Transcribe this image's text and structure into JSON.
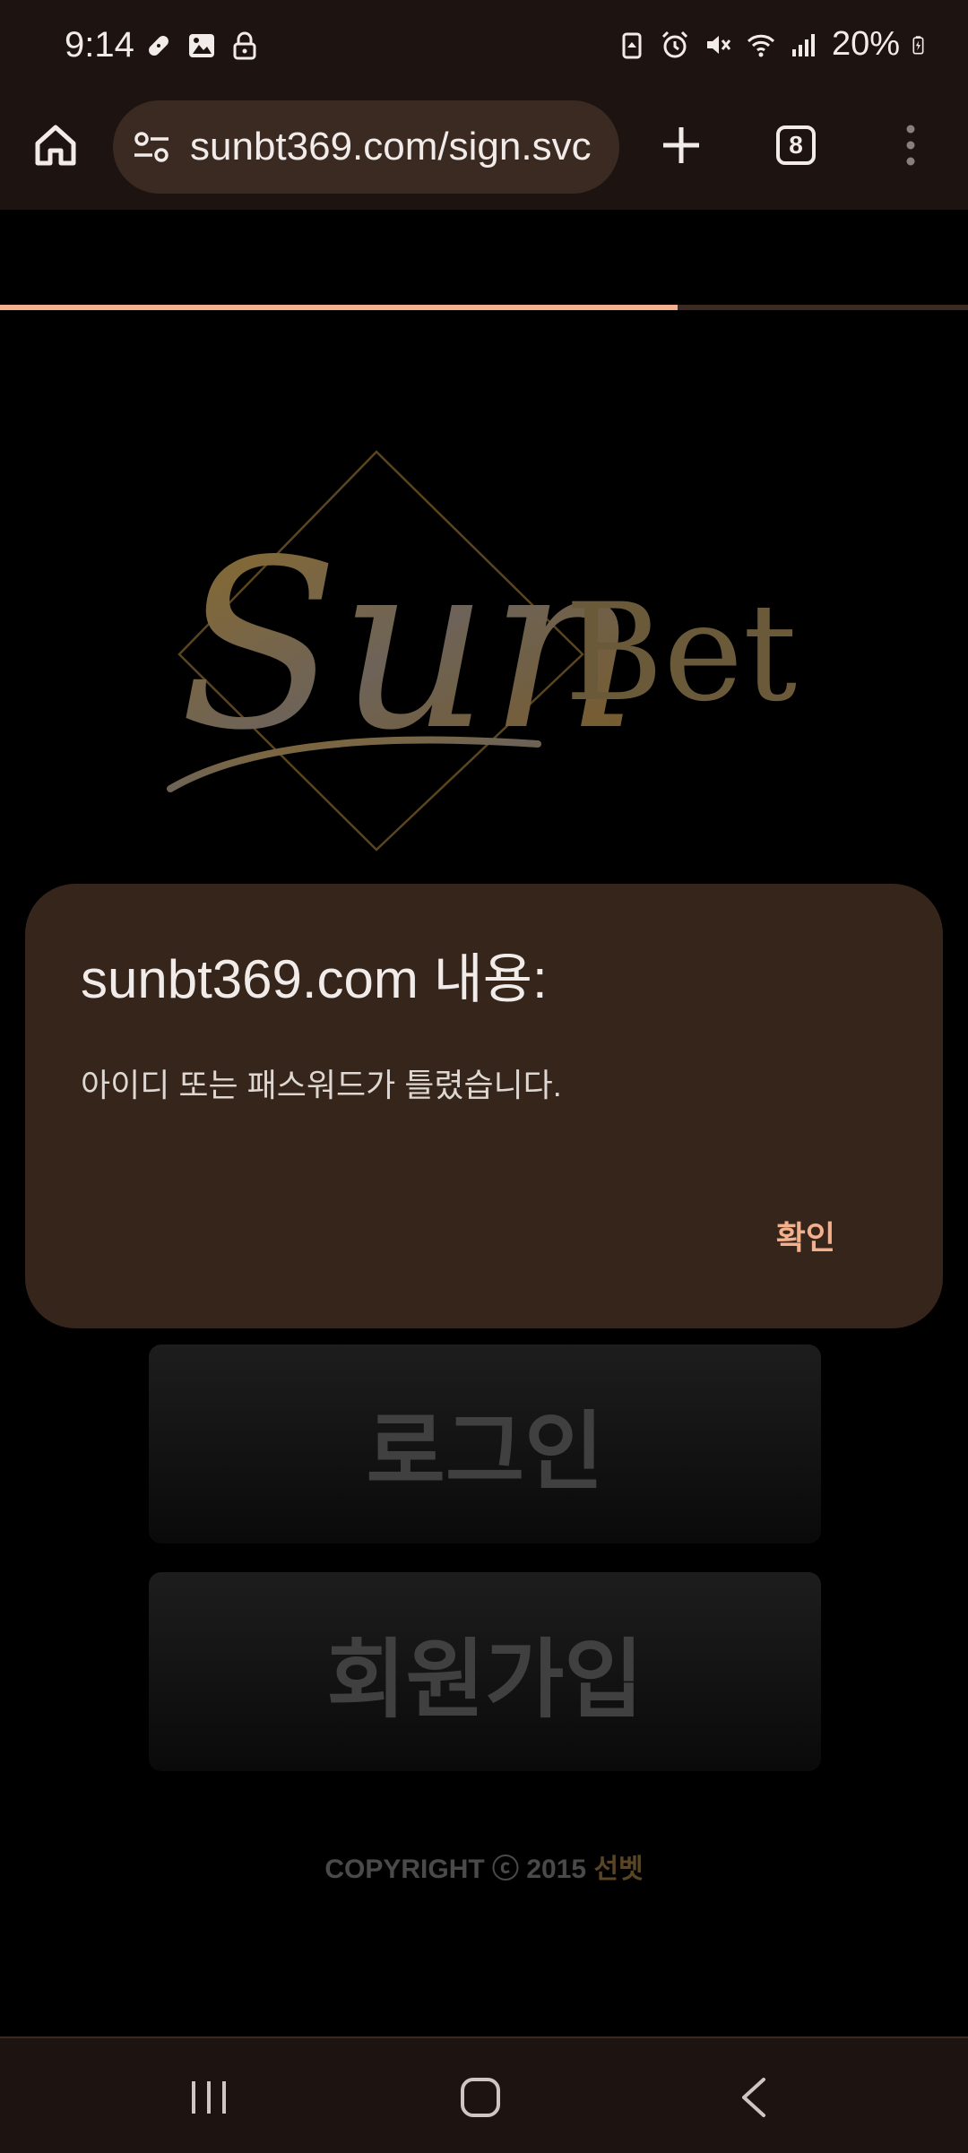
{
  "status_bar": {
    "time": "9:14",
    "battery_percent": "20%",
    "left_icons": [
      "bandage-icon",
      "image-icon",
      "lock-icon"
    ],
    "right_icons": [
      "battery-saver-icon",
      "alarm-icon",
      "mute-icon",
      "wifi-icon",
      "signal-icon",
      "battery-icon"
    ]
  },
  "browser": {
    "url": "sunbt369.com/sign.svc",
    "tab_count": "8",
    "load_progress": 0.7
  },
  "page": {
    "logo_script": "Sun",
    "logo_serif": "Bet",
    "login_label": "로그인",
    "signup_label": "회원가입",
    "copyright_text": "COPYRIGHT ⓒ 2015 ",
    "copyright_brand": "선벳"
  },
  "dialog": {
    "title": "sunbt369.com 내용:",
    "message": "아이디 또는 패스워드가 틀렸습니다.",
    "ok_label": "확인"
  },
  "colors": {
    "chrome": "#1d1311",
    "dialog_bg": "#35251b",
    "accent": "#f2b08c",
    "gold": "#7a5a22"
  }
}
